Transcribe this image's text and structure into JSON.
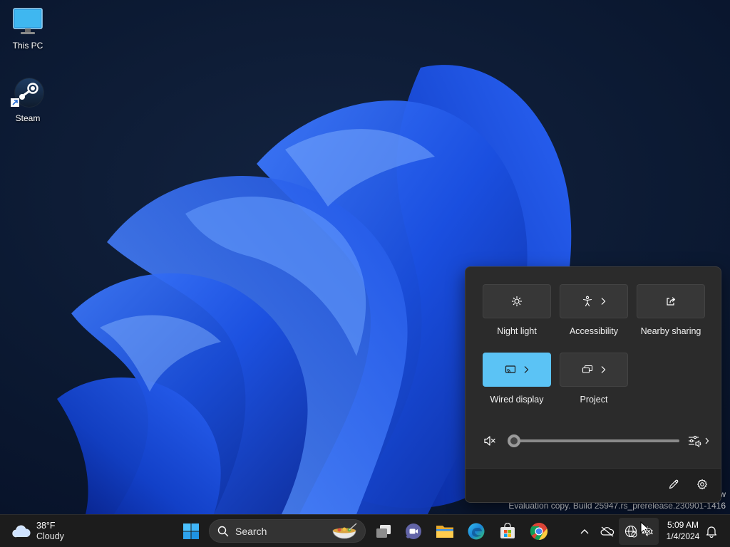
{
  "desktop": {
    "icons": [
      {
        "label": "This PC",
        "icon": "monitor-icon"
      },
      {
        "label": "Steam",
        "icon": "steam-icon"
      }
    ],
    "watermark": {
      "line1": "w",
      "line2": "Evaluation copy. Build 25947.rs_prerelease.230901-1416"
    }
  },
  "quick_settings": {
    "tiles": [
      {
        "label": "Night light",
        "icon": "brightness-icon",
        "active": false,
        "has_chevron": false
      },
      {
        "label": "Accessibility",
        "icon": "accessibility-icon",
        "active": false,
        "has_chevron": true
      },
      {
        "label": "Nearby sharing",
        "icon": "share-icon",
        "active": false,
        "has_chevron": false
      },
      {
        "label": "Wired display",
        "icon": "cast-icon",
        "active": true,
        "has_chevron": true
      },
      {
        "label": "Project",
        "icon": "project-icon",
        "active": false,
        "has_chevron": true
      }
    ],
    "volume": {
      "muted": true,
      "level_percent": 0
    },
    "colors": {
      "accent": "#5bc3f5",
      "panel": "#2b2b2b",
      "footer": "#202020"
    }
  },
  "taskbar": {
    "weather": {
      "temp": "38°F",
      "condition": "Cloudy",
      "icon": "cloudy-icon"
    },
    "search": {
      "placeholder": "Search"
    },
    "apps": [
      "start-icon",
      "task-view-icon",
      "teams-icon",
      "file-explorer-icon",
      "edge-icon",
      "store-icon",
      "chrome-icon"
    ],
    "tray": [
      "chevron-up-icon",
      "onedrive-offline-icon",
      "network-icon",
      "volume-muted-icon",
      "notification-bell-icon"
    ],
    "clock": {
      "time": "5:09 AM",
      "date": "1/4/2024"
    }
  }
}
